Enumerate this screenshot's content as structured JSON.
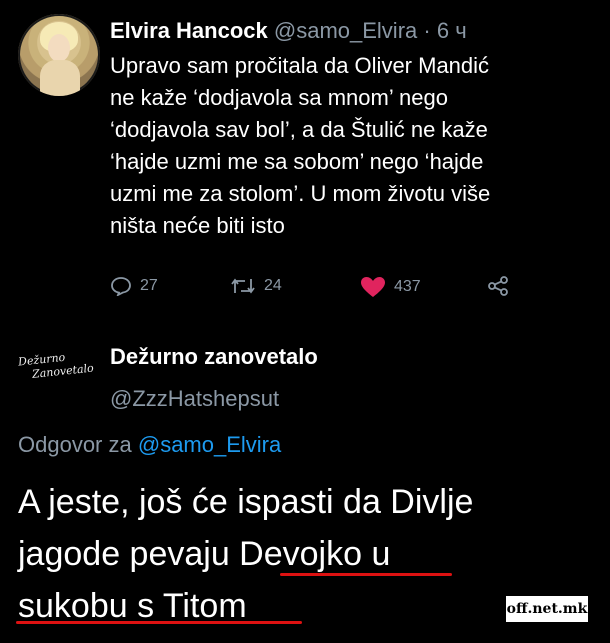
{
  "tweet1": {
    "name": "Elvira Hancock",
    "handle": "@samo_Elvira",
    "dot": "·",
    "time": "6 ч",
    "lines": [
      "Upravo sam pročitala da Oliver Mandić",
      "ne kaže ‘dodjavola sa mnom’ nego",
      "‘dodjavola sav bol’, a da Štulić ne kaže",
      "‘hajde uzmi me sa sobom’ nego ‘hajde",
      "uzmi me za stolom’. U mom životu više",
      "ništa neće biti isto"
    ],
    "replies": "27",
    "retweets": "24",
    "likes": "437",
    "like_color": "#e0245e"
  },
  "tweet2": {
    "avatar_text_line1": "Dežurno",
    "avatar_text_line2": "Zanovetalo",
    "name": "Dežurno zanovetalo",
    "handle": "@ZzzHatshepsut",
    "reply_prefix": "Odgovor za",
    "reply_mention": "@samo_Elvira",
    "lines": [
      "A jeste, još će ispasti da Divlje",
      "jagode pevaju Devojko u",
      "sukobu s Titom"
    ],
    "mention_color": "#1d9bf0",
    "underline_color": "#dd1111"
  },
  "watermark": "off.net.mk"
}
